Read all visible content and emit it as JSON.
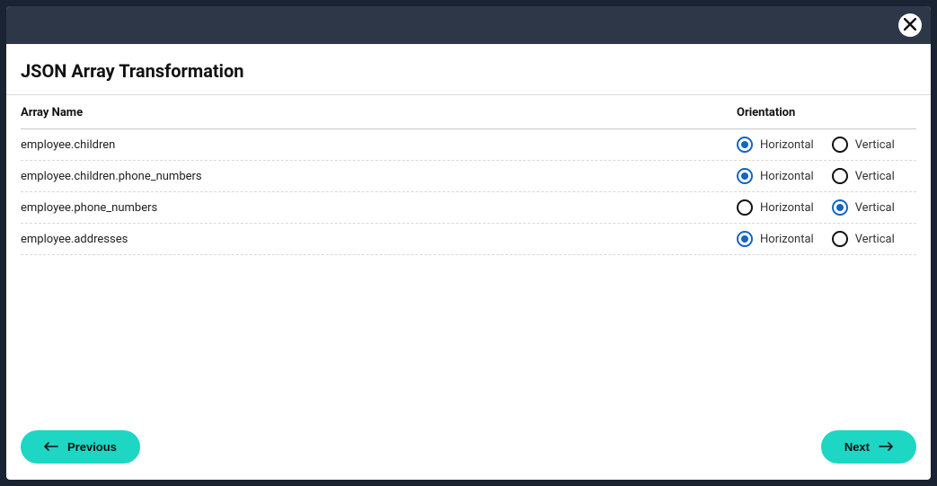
{
  "modal": {
    "title": "JSON Array Transformation"
  },
  "table": {
    "header_name": "Array Name",
    "header_orientation": "Orientation",
    "option_horizontal": "Horizontal",
    "option_vertical": "Vertical",
    "rows": [
      {
        "name": "employee.children",
        "horizontal": true
      },
      {
        "name": "employee.children.phone_numbers",
        "horizontal": true
      },
      {
        "name": "employee.phone_numbers",
        "horizontal": false
      },
      {
        "name": "employee.addresses",
        "horizontal": true
      }
    ]
  },
  "footer": {
    "previous": "Previous",
    "next": "Next"
  }
}
